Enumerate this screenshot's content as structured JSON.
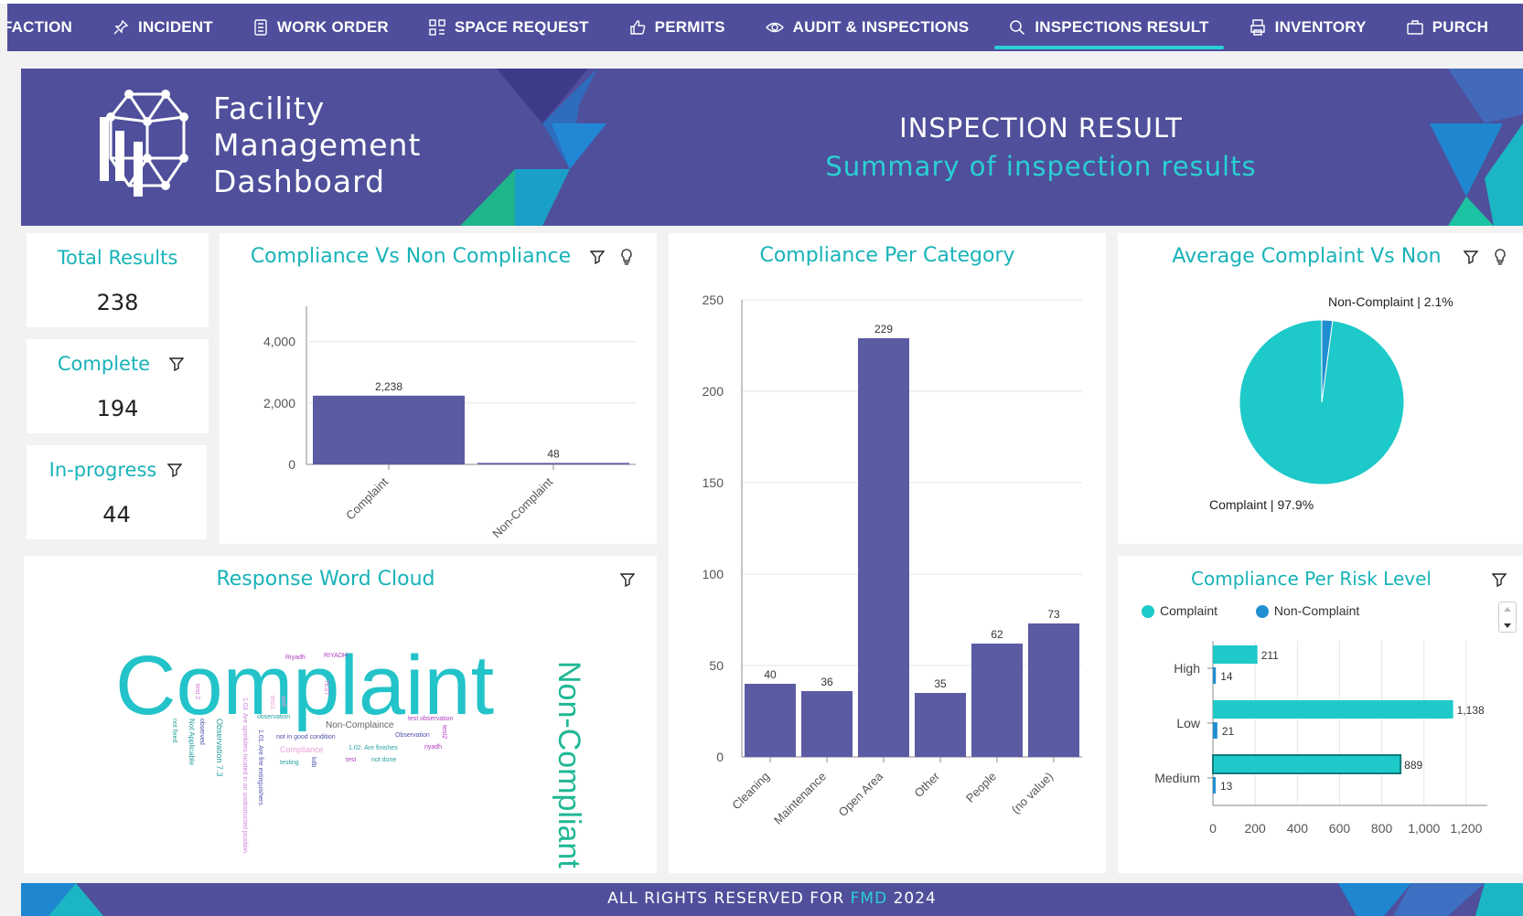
{
  "nav": {
    "tabs": [
      {
        "label": "FACTION",
        "icon": "none",
        "active": false
      },
      {
        "label": "INCIDENT",
        "icon": "pin-icon",
        "active": false
      },
      {
        "label": "WORK ORDER",
        "icon": "document-list-icon",
        "active": false
      },
      {
        "label": "SPACE REQUEST",
        "icon": "grid-icon",
        "active": false
      },
      {
        "label": "PERMITS",
        "icon": "thumbs-up-icon",
        "active": false
      },
      {
        "label": "AUDIT & INSPECTIONS",
        "icon": "eye-icon",
        "active": false
      },
      {
        "label": "INSPECTIONS RESULT",
        "icon": "search-icon",
        "active": true
      },
      {
        "label": "INVENTORY",
        "icon": "printer-icon",
        "active": false
      },
      {
        "label": "PURCH",
        "icon": "briefcase-icon",
        "active": false
      }
    ]
  },
  "banner": {
    "logo_line1": "Facility",
    "logo_line2": "Management",
    "logo_line3": "Dashboard",
    "title": "INSPECTION RESULT",
    "subtitle": "Summary of inspection results"
  },
  "kpis": {
    "total": {
      "label": "Total Results",
      "value": "238"
    },
    "complete": {
      "label": "Complete",
      "value": "194"
    },
    "inprogress": {
      "label": "In-progress",
      "value": "44"
    }
  },
  "cards": {
    "compliance_title": "Compliance Vs Non Compliance",
    "category_title": "Compliance Per Category",
    "average_title": "Average Complaint Vs Non",
    "wordcloud_title": "Response Word Cloud",
    "risk_title": "Compliance Per Risk Level"
  },
  "wordcloud": {
    "big": "Complaint",
    "vertical": "Non-Compliant",
    "small": [
      "Riyadh",
      "RIYADH",
      "TEST",
      "observation",
      "Non-Complaince",
      "test observation",
      "not in good condition",
      "Observation",
      "riyadh",
      "Compliance",
      "1.02. Are finishes",
      "test",
      "testing",
      "not done",
      "Observation 7.3",
      "Not Applicable",
      "observed",
      "not fixed",
      "test2",
      "well",
      "test 2",
      "test1",
      "1.01. Are fire extinguishers",
      "kdb"
    ]
  },
  "footer": {
    "prefix": "ALL RIGHTS RESERVED FOR",
    "brand": "FMD",
    "year": "2024"
  },
  "colors": {
    "purple": "#5b5ba4",
    "teal": "#1ec9c9",
    "blue": "#1f8fd1",
    "title_teal": "#17b3b8"
  },
  "chart_data": [
    {
      "type": "bar",
      "title": "Compliance Vs Non Compliance",
      "categories": [
        "Complaint",
        "Non-Complaint"
      ],
      "values": [
        2238,
        48
      ],
      "value_labels": [
        "2,238",
        "48"
      ],
      "yticks": [
        "0",
        "2,000",
        "4,000"
      ],
      "ylim": [
        0,
        5000
      ]
    },
    {
      "type": "bar",
      "title": "Compliance Per Category",
      "categories": [
        "Cleaning",
        "Maintenance",
        "Open Area",
        "Other",
        "People",
        "(no value)"
      ],
      "values": [
        40,
        36,
        229,
        35,
        62,
        73
      ],
      "yticks": [
        "0",
        "50",
        "100",
        "150",
        "200",
        "250"
      ],
      "ylim": [
        0,
        250
      ]
    },
    {
      "type": "pie",
      "title": "Average Complaint Vs Non",
      "slices": [
        {
          "name": "Complaint",
          "value": 97.9,
          "label": "Complaint | 97.9%"
        },
        {
          "name": "Non-Complaint",
          "value": 2.1,
          "label": "Non-Complaint | 2.1%"
        }
      ]
    },
    {
      "type": "bar",
      "orientation": "horizontal",
      "title": "Compliance Per Risk Level",
      "categories": [
        "High",
        "Low",
        "Medium"
      ],
      "series": [
        {
          "name": "Complaint",
          "values": [
            211,
            1138,
            889
          ],
          "labels": [
            "211",
            "1,138",
            "889"
          ]
        },
        {
          "name": "Non-Complaint",
          "values": [
            14,
            21,
            13
          ],
          "labels": [
            "14",
            "21",
            "13"
          ]
        }
      ],
      "xticks": [
        "0",
        "200",
        "400",
        "600",
        "800",
        "1,000",
        "1,200"
      ],
      "xlim": [
        0,
        1300
      ],
      "legend": "top-left"
    }
  ]
}
